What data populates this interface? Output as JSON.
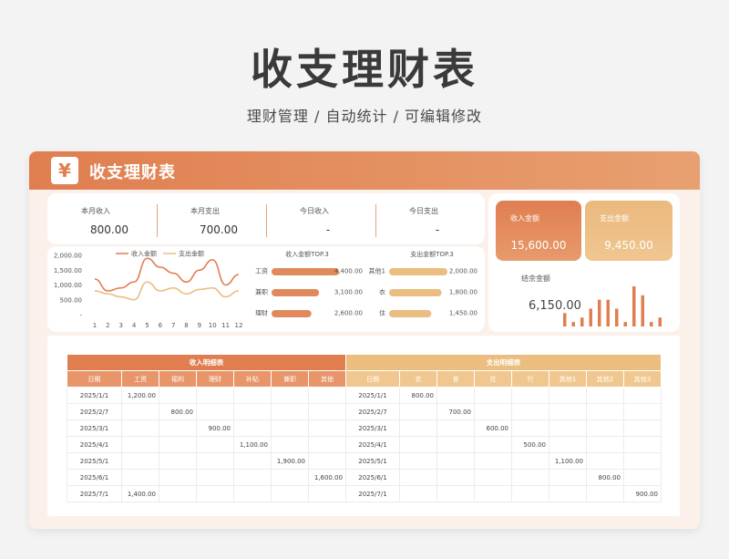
{
  "page": {
    "title": "收支理财表",
    "subtitle": "理财管理 /  自动统计  /  可编辑修改"
  },
  "header": {
    "logo_glyph": "¥",
    "title": "收支理财表"
  },
  "kpis": [
    {
      "label": "本月收入",
      "value": "800.00"
    },
    {
      "label": "本月支出",
      "value": "700.00"
    },
    {
      "label": "今日收入",
      "value": "-"
    },
    {
      "label": "今日支出",
      "value": "-"
    }
  ],
  "stats": {
    "income": {
      "label": "收入金额",
      "value": "15,600.00"
    },
    "expense": {
      "label": "支出金额",
      "value": "9,450.00"
    },
    "balance": {
      "label": "结余金额",
      "value": "6,150.00"
    }
  },
  "colors": {
    "accent": "#e07e50",
    "accent_light": "#ebbd7e",
    "bg": "#fbf1ea"
  },
  "chart_data": [
    {
      "type": "line",
      "legend": [
        "收入金额",
        "支出金额"
      ],
      "x": [
        "1",
        "2",
        "3",
        "4",
        "5",
        "6",
        "7",
        "8",
        "9",
        "10",
        "11",
        "12"
      ],
      "yticks": [
        "2,000.00",
        "1,500.00",
        "1,000.00",
        "500.00",
        "-"
      ],
      "ylim": [
        0,
        2000
      ],
      "series": [
        {
          "name": "收入金额",
          "values": [
            1200,
            800,
            900,
            1100,
            1900,
            1600,
            1400,
            1100,
            1500,
            1850,
            1000,
            1350
          ]
        },
        {
          "name": "支出金额",
          "values": [
            800,
            700,
            600,
            500,
            1100,
            800,
            900,
            700,
            850,
            900,
            600,
            800
          ]
        }
      ]
    },
    {
      "type": "bar",
      "title": "收入金额TOP.3",
      "categories": [
        "工资",
        "兼职",
        "理财"
      ],
      "values": [
        4400,
        3100,
        2600
      ],
      "labels": [
        "4,400.00",
        "3,100.00",
        "2,600.00"
      ]
    },
    {
      "type": "bar",
      "title": "支出金额TOP.3",
      "categories": [
        "其他1",
        "衣",
        "住"
      ],
      "values": [
        2000,
        1800,
        1450
      ],
      "labels": [
        "2,000.00",
        "1,800.00",
        "1,450.00"
      ]
    },
    {
      "type": "bar",
      "values": [
        3,
        1,
        2,
        4,
        6,
        6,
        4,
        1,
        9,
        7,
        1,
        2
      ]
    }
  ],
  "income_table": {
    "title": "收入明细表",
    "columns": [
      "日期",
      "工资",
      "福利",
      "理财",
      "补贴",
      "兼职",
      "其他"
    ],
    "rows": [
      [
        "2025/1/1",
        "1,200.00",
        "",
        "",
        "",
        "",
        ""
      ],
      [
        "2025/2/7",
        "",
        "800.00",
        "",
        "",
        "",
        ""
      ],
      [
        "2025/3/1",
        "",
        "",
        "900.00",
        "",
        "",
        ""
      ],
      [
        "2025/4/1",
        "",
        "",
        "",
        "1,100.00",
        "",
        ""
      ],
      [
        "2025/5/1",
        "",
        "",
        "",
        "",
        "1,900.00",
        ""
      ],
      [
        "2025/6/1",
        "",
        "",
        "",
        "",
        "",
        "1,600.00"
      ],
      [
        "2025/7/1",
        "1,400.00",
        "",
        "",
        "",
        "",
        ""
      ]
    ]
  },
  "expense_table": {
    "title": "支出明细表",
    "columns": [
      "日期",
      "衣",
      "食",
      "住",
      "行",
      "其他1",
      "其他2",
      "其他3"
    ],
    "rows": [
      [
        "2025/1/1",
        "800.00",
        "",
        "",
        "",
        "",
        "",
        ""
      ],
      [
        "2025/2/7",
        "",
        "700.00",
        "",
        "",
        "",
        "",
        ""
      ],
      [
        "2025/3/1",
        "",
        "",
        "600.00",
        "",
        "",
        "",
        ""
      ],
      [
        "2025/4/1",
        "",
        "",
        "",
        "500.00",
        "",
        "",
        ""
      ],
      [
        "2025/5/1",
        "",
        "",
        "",
        "",
        "1,100.00",
        "",
        ""
      ],
      [
        "2025/6/1",
        "",
        "",
        "",
        "",
        "",
        "800.00",
        ""
      ],
      [
        "2025/7/1",
        "",
        "",
        "",
        "",
        "",
        "",
        "900.00"
      ]
    ]
  }
}
